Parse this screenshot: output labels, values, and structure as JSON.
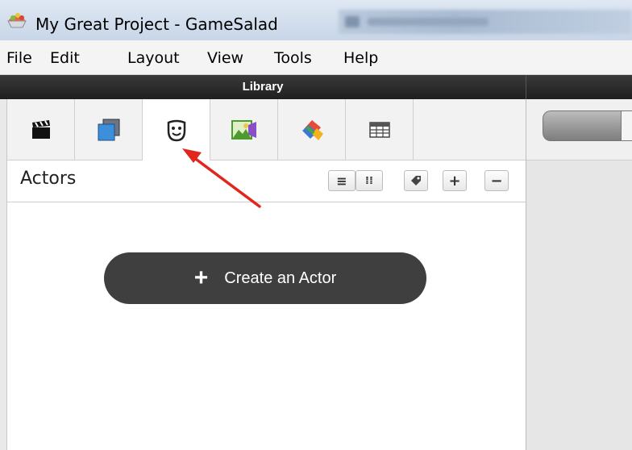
{
  "window": {
    "title": "My Great Project - GameSalad"
  },
  "menu": {
    "items": [
      "File",
      "Edit",
      "Layout",
      "View",
      "Tools",
      "Help"
    ]
  },
  "library": {
    "header": "Library",
    "tabs": [
      {
        "name": "scenes",
        "icon": "clapperboard-icon"
      },
      {
        "name": "layers",
        "icon": "stacked-squares-icon"
      },
      {
        "name": "actors",
        "icon": "mask-icon",
        "active": true
      },
      {
        "name": "images",
        "icon": "image-icon"
      },
      {
        "name": "behaviors",
        "icon": "puzzle-icon"
      },
      {
        "name": "tables",
        "icon": "table-icon"
      }
    ],
    "section_title": "Actors",
    "tools": {
      "list_view": "≡",
      "grid_view": "⁞⁞",
      "tag": "tag-icon",
      "add": "+",
      "remove": "−"
    },
    "create_button": {
      "plus": "+",
      "label": "Create an Actor"
    }
  },
  "colors": {
    "arrow": "#e0271d",
    "header_bg": "#2a2a2a",
    "button_bg": "#3f3f3f"
  }
}
